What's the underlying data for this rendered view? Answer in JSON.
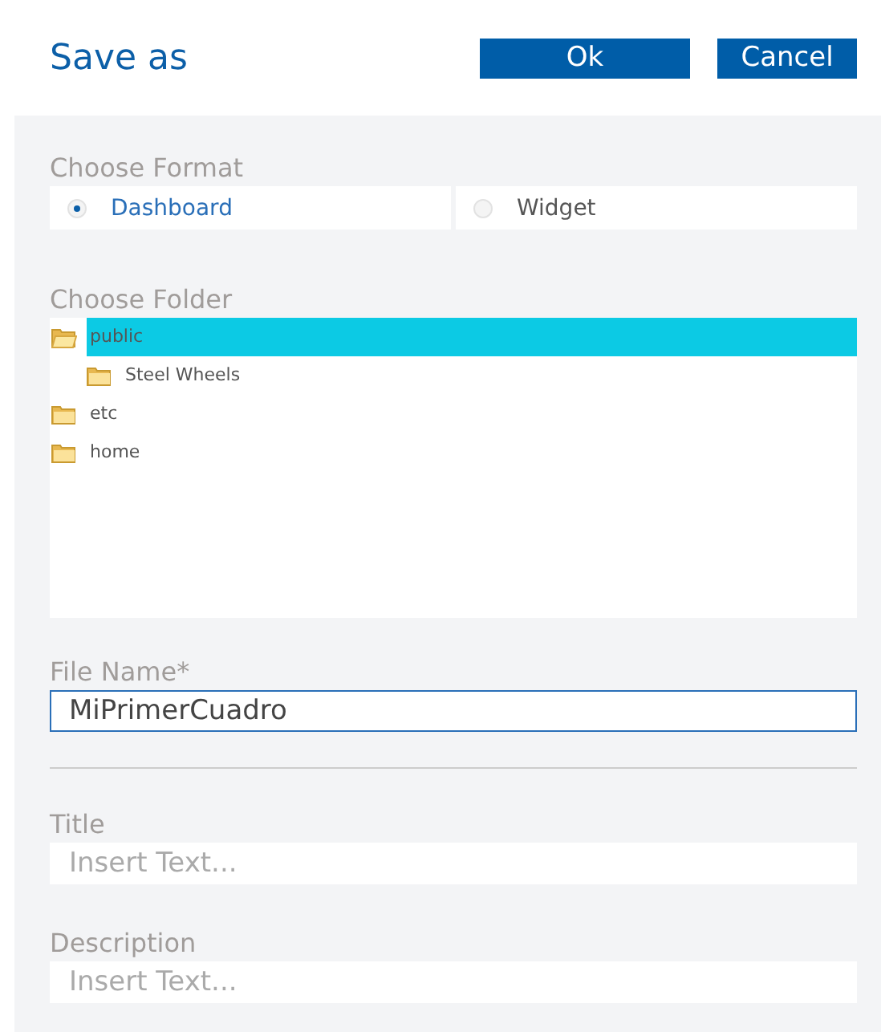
{
  "dialog": {
    "title": "Save as"
  },
  "buttons": [
    {
      "label": "Ok",
      "kind": "primary"
    },
    {
      "label": "Cancel",
      "kind": "secondary"
    }
  ],
  "format": {
    "label": "Choose Format",
    "options": [
      {
        "label": "Dashboard",
        "selected": true
      },
      {
        "label": "Widget",
        "selected": false
      }
    ]
  },
  "folder": {
    "label": "Choose Folder",
    "tree": [
      {
        "name": "public",
        "selected": true,
        "expanded": true,
        "children": [
          {
            "name": "Steel Wheels",
            "selected": false,
            "expanded": false
          }
        ]
      },
      {
        "name": "etc",
        "selected": false,
        "expanded": false
      },
      {
        "name": "home",
        "selected": false,
        "expanded": false
      }
    ]
  },
  "file_name": {
    "label": "File Name*",
    "value": "MiPrimerCuadro"
  },
  "title_field": {
    "label": "Title",
    "placeholder": "Insert Text..."
  },
  "description_field": {
    "label": "Description",
    "placeholder": "Insert Text..."
  }
}
